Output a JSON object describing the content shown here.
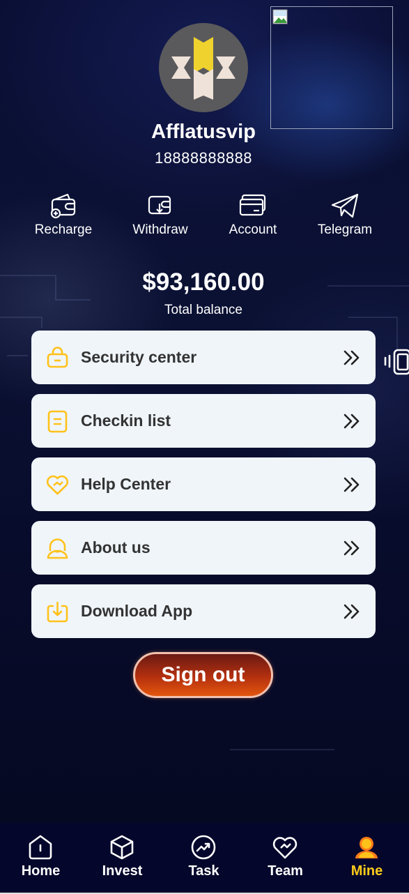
{
  "profile": {
    "name": "Afflatusvip",
    "phone": "18888888888",
    "avatar_icon": "brand-logo",
    "top_image_icon": "broken-image-icon"
  },
  "quick_actions": [
    {
      "label": "Recharge",
      "icon": "wallet-plus-icon"
    },
    {
      "label": "Withdraw",
      "icon": "wallet-withdraw-icon"
    },
    {
      "label": "Account",
      "icon": "card-icon"
    },
    {
      "label": "Telegram",
      "icon": "telegram-icon"
    }
  ],
  "balance": {
    "amount": "$93,160.00",
    "label": "Total balance"
  },
  "menu": [
    {
      "label": "Security center",
      "icon": "lock-icon"
    },
    {
      "label": "Checkin list",
      "icon": "list-icon"
    },
    {
      "label": "Help Center",
      "icon": "heart-handshake-icon"
    },
    {
      "label": "About us",
      "icon": "smile-icon"
    },
    {
      "label": "Download App",
      "icon": "download-icon"
    }
  ],
  "sign_out_label": "Sign out",
  "tabs": [
    {
      "label": "Home",
      "icon": "home-icon",
      "active": false
    },
    {
      "label": "Invest",
      "icon": "cube-icon",
      "active": false
    },
    {
      "label": "Task",
      "icon": "trend-icon",
      "active": false
    },
    {
      "label": "Team",
      "icon": "heart-team-icon",
      "active": false
    },
    {
      "label": "Mine",
      "icon": "user-icon",
      "active": true
    }
  ],
  "colors": {
    "accent": "#ffcc1a",
    "card_bg": "#f0f5fa",
    "menu_text": "#333333",
    "background": "#070b2a",
    "tabbar_bg": "#04062b",
    "signout_gradient_start": "#6a1a14",
    "signout_gradient_end": "#e2560e"
  }
}
